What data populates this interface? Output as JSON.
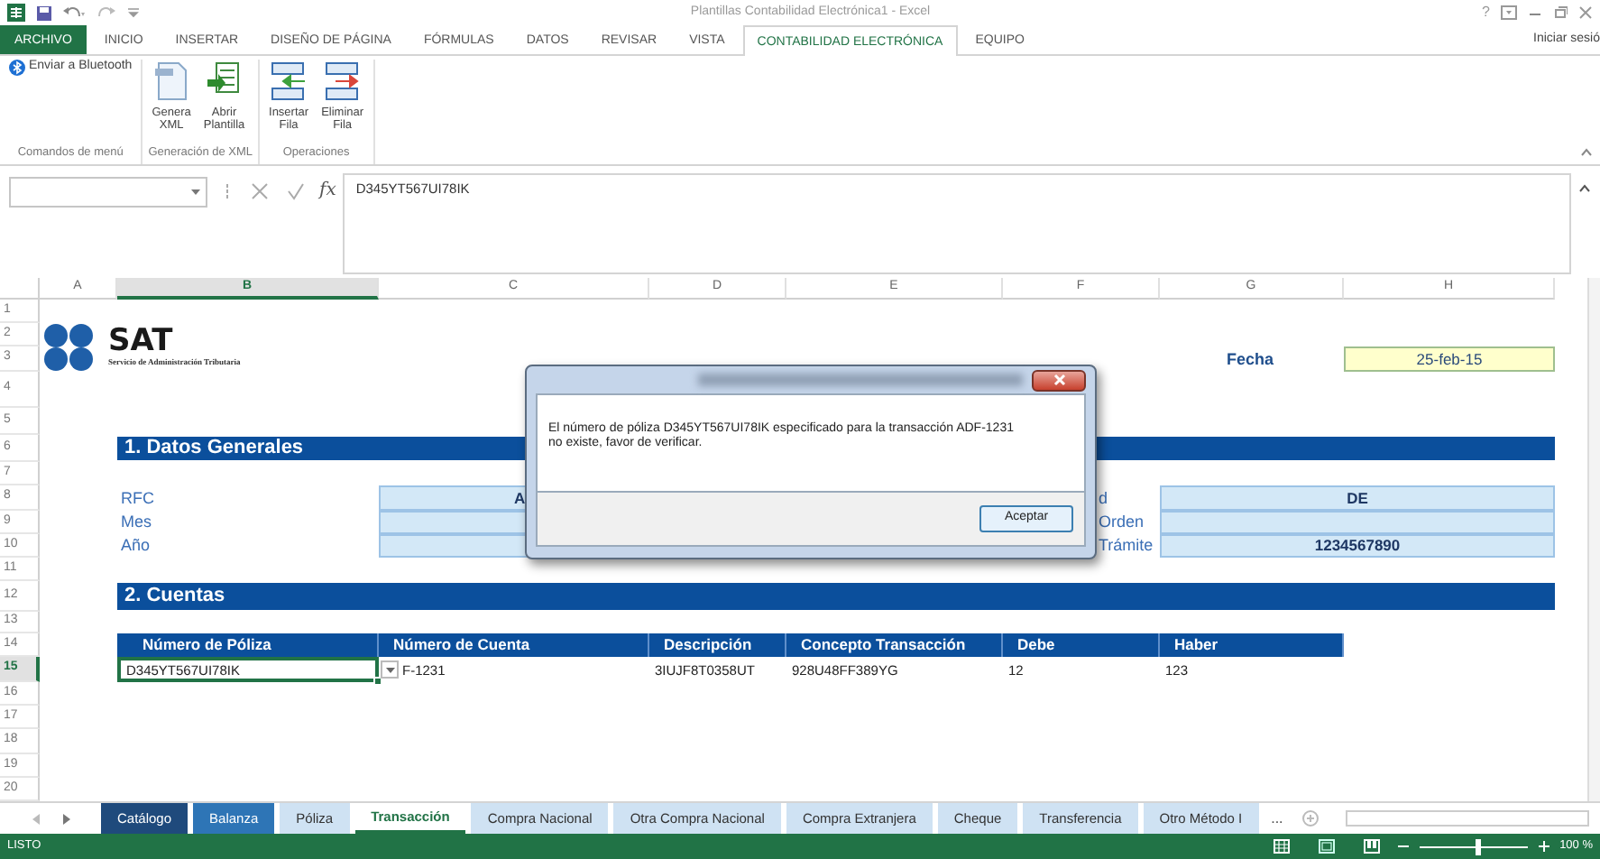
{
  "window": {
    "title": "Plantillas Contabilidad Electrónica1 - Excel",
    "help": "?",
    "sign_in": "Iniciar sesió"
  },
  "ribbon_tabs": [
    {
      "label": "ARCHIVO",
      "kind": "file",
      "selected": false
    },
    {
      "label": "INICIO",
      "kind": "tab",
      "selected": false
    },
    {
      "label": "INSERTAR",
      "kind": "tab",
      "selected": false
    },
    {
      "label": "DISEÑO DE PÁGINA",
      "kind": "tab",
      "selected": false
    },
    {
      "label": "FÓRMULAS",
      "kind": "tab",
      "selected": false
    },
    {
      "label": "DATOS",
      "kind": "tab",
      "selected": false
    },
    {
      "label": "REVISAR",
      "kind": "tab",
      "selected": false
    },
    {
      "label": "VISTA",
      "kind": "tab",
      "selected": false
    },
    {
      "label": "CONTABILIDAD ELECTRÓNICA",
      "kind": "tab",
      "selected": true
    },
    {
      "label": "EQUIPO",
      "kind": "tab",
      "selected": false
    }
  ],
  "ribbon_groups": [
    {
      "label": "Comandos de menú",
      "buttons": [
        {
          "label": "Enviar a Bluetooth",
          "kind": "small"
        }
      ]
    },
    {
      "label": "Generación de XML",
      "buttons": [
        {
          "label": "Genera XML",
          "kind": "large"
        },
        {
          "label": "Abrir Plantilla",
          "kind": "large"
        }
      ]
    },
    {
      "label": "Operaciones",
      "buttons": [
        {
          "label": "Insertar Fila",
          "kind": "large"
        },
        {
          "label": "Eliminar Fila",
          "kind": "large"
        }
      ]
    }
  ],
  "formula_bar": {
    "function_label": "fx",
    "formula": "D345YT567UI78IK"
  },
  "sheet": {
    "columns": [
      {
        "label": "A",
        "selected": false
      },
      {
        "label": "B",
        "selected": true
      },
      {
        "label": "C",
        "selected": false
      },
      {
        "label": "D",
        "selected": false
      },
      {
        "label": "E",
        "selected": false
      },
      {
        "label": "F",
        "selected": false
      },
      {
        "label": "G",
        "selected": false
      },
      {
        "label": "H",
        "selected": false
      }
    ],
    "rows": [
      {
        "label": "1",
        "selected": false
      },
      {
        "label": "2",
        "selected": false
      },
      {
        "label": "3",
        "selected": false
      },
      {
        "label": "4",
        "selected": false
      },
      {
        "label": "5",
        "selected": false
      },
      {
        "label": "6",
        "selected": false
      },
      {
        "label": "7",
        "selected": false
      },
      {
        "label": "8",
        "selected": false
      },
      {
        "label": "9",
        "selected": false
      },
      {
        "label": "10",
        "selected": false
      },
      {
        "label": "11",
        "selected": false
      },
      {
        "label": "12",
        "selected": false
      },
      {
        "label": "13",
        "selected": false
      },
      {
        "label": "14",
        "selected": false
      },
      {
        "label": "15",
        "selected": true
      },
      {
        "label": "16",
        "selected": false
      },
      {
        "label": "17",
        "selected": false
      },
      {
        "label": "18",
        "selected": false
      },
      {
        "label": "19",
        "selected": false
      },
      {
        "label": "20",
        "selected": false
      }
    ],
    "header": {
      "logo_text": "SAT",
      "logo_subtitle": "Servicio de Administración Tributaria",
      "date_label": "Fecha",
      "date_value": "25-feb-15"
    },
    "datos_generales": {
      "title": "1. Datos Generales",
      "fields": [
        {
          "label": "RFC",
          "value": "A",
          "label_2": "d",
          "value_2": "DE"
        },
        {
          "label": "Mes",
          "label_2": "Orden"
        },
        {
          "label": "Año",
          "label_2": "Trámite",
          "value_2": "1234567890"
        }
      ]
    },
    "cuentas": {
      "title": "2. Cuentas",
      "columns": [
        "Número de Póliza",
        "Número de Cuenta",
        "Descripción",
        "Concepto Transacción",
        "Debe",
        "Haber"
      ],
      "rows": [
        {
          "cells": [
            {
              "text": "D345YT567UI78IK",
              "selected": true
            },
            {
              "text": "F-1231",
              "selected": false
            },
            {
              "text": "3IUJF8T0358UT",
              "selected": false
            },
            {
              "text": "928U48FF389YG",
              "selected": false
            },
            {
              "text": "12",
              "selected": false
            },
            {
              "text": "123",
              "selected": false
            }
          ]
        }
      ]
    }
  },
  "dialog": {
    "message": "El número de póliza D345YT567UI78IK especificado para la transacción ADF-1231\nno existe, favor de verificar.",
    "button": "Aceptar"
  },
  "sheet_tabs": [
    {
      "label": "Catálogo",
      "color": "#1f4a7c",
      "selected": false
    },
    {
      "label": "Balanza",
      "color": "#2e75b6",
      "selected": false
    },
    {
      "label": "Póliza",
      "color": "#cfe2f3",
      "selected": false
    },
    {
      "label": "Transacción",
      "color": "#ffffff",
      "selected": true
    },
    {
      "label": "Compra Nacional",
      "color": "#cfe2f3",
      "selected": false
    },
    {
      "label": "Otra Compra Nacional",
      "color": "#cfe2f3",
      "selected": false
    },
    {
      "label": "Compra Extranjera",
      "color": "#cfe2f3",
      "selected": false
    },
    {
      "label": "Cheque",
      "color": "#cfe2f3",
      "selected": false
    },
    {
      "label": "Transferencia",
      "color": "#cfe2f3",
      "selected": false
    },
    {
      "label": "Otro Método I",
      "color": "#cfe2f3",
      "selected": false
    }
  ],
  "more_tabs": "...",
  "status_bar": {
    "text": "LISTO",
    "zoom": "100 %",
    "zoom_slider": {
      "level": 0.55
    }
  }
}
